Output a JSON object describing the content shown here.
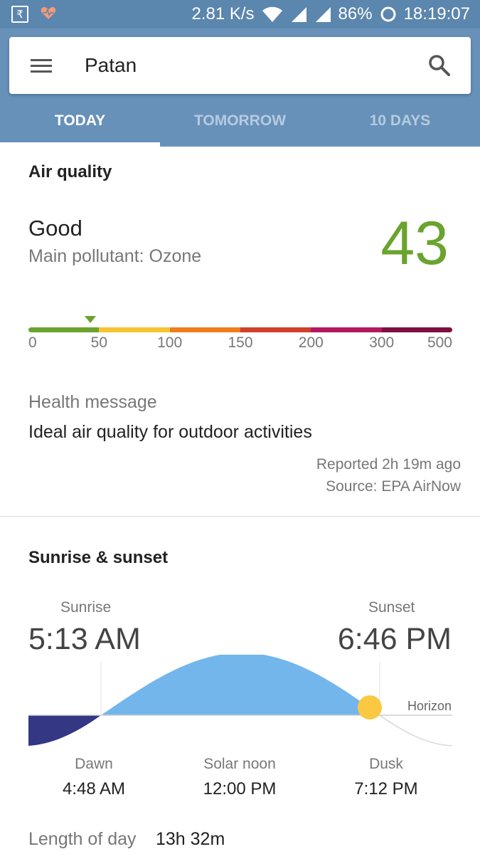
{
  "status_bar": {
    "left_icon": "₹",
    "speed": "2.81 K/s",
    "battery": "86%",
    "time": "18:19:07"
  },
  "search": {
    "city": "Patan"
  },
  "tabs": [
    {
      "label": "TODAY",
      "active": true
    },
    {
      "label": "TOMORROW",
      "active": false
    },
    {
      "label": "10 DAYS",
      "active": false
    }
  ],
  "air_quality": {
    "title": "Air quality",
    "status": "Good",
    "pollutant": "Main pollutant: Ozone",
    "value": "43",
    "value_color": "#6aa32e",
    "scale_ticks": [
      "0",
      "50",
      "100",
      "150",
      "200",
      "300",
      "500"
    ],
    "scale_colors": [
      "#6aa32e",
      "#f6c431",
      "#ef7d1a",
      "#d0402c",
      "#b3185f",
      "#7d1040"
    ],
    "marker_fraction": 0.146,
    "health_label": "Health message",
    "health_text": "Ideal air quality for outdoor activities",
    "reported": "Reported 2h 19m ago",
    "source": "Source: EPA AirNow"
  },
  "sun": {
    "title": "Sunrise & sunset",
    "sunrise_label": "Sunrise",
    "sunrise_time": "5:13 AM",
    "sunset_label": "Sunset",
    "sunset_time": "6:46 PM",
    "horizon_label": "Horizon",
    "dawn_label": "Dawn",
    "dawn_time": "4:48 AM",
    "noon_label": "Solar noon",
    "noon_time": "12:00 PM",
    "dusk_label": "Dusk",
    "dusk_time": "7:12 PM",
    "length_label": "Length of day",
    "length_value": "13h 32m",
    "day_color": "#72b6ec",
    "night_color": "#343784",
    "sun_color": "#fbc842"
  }
}
